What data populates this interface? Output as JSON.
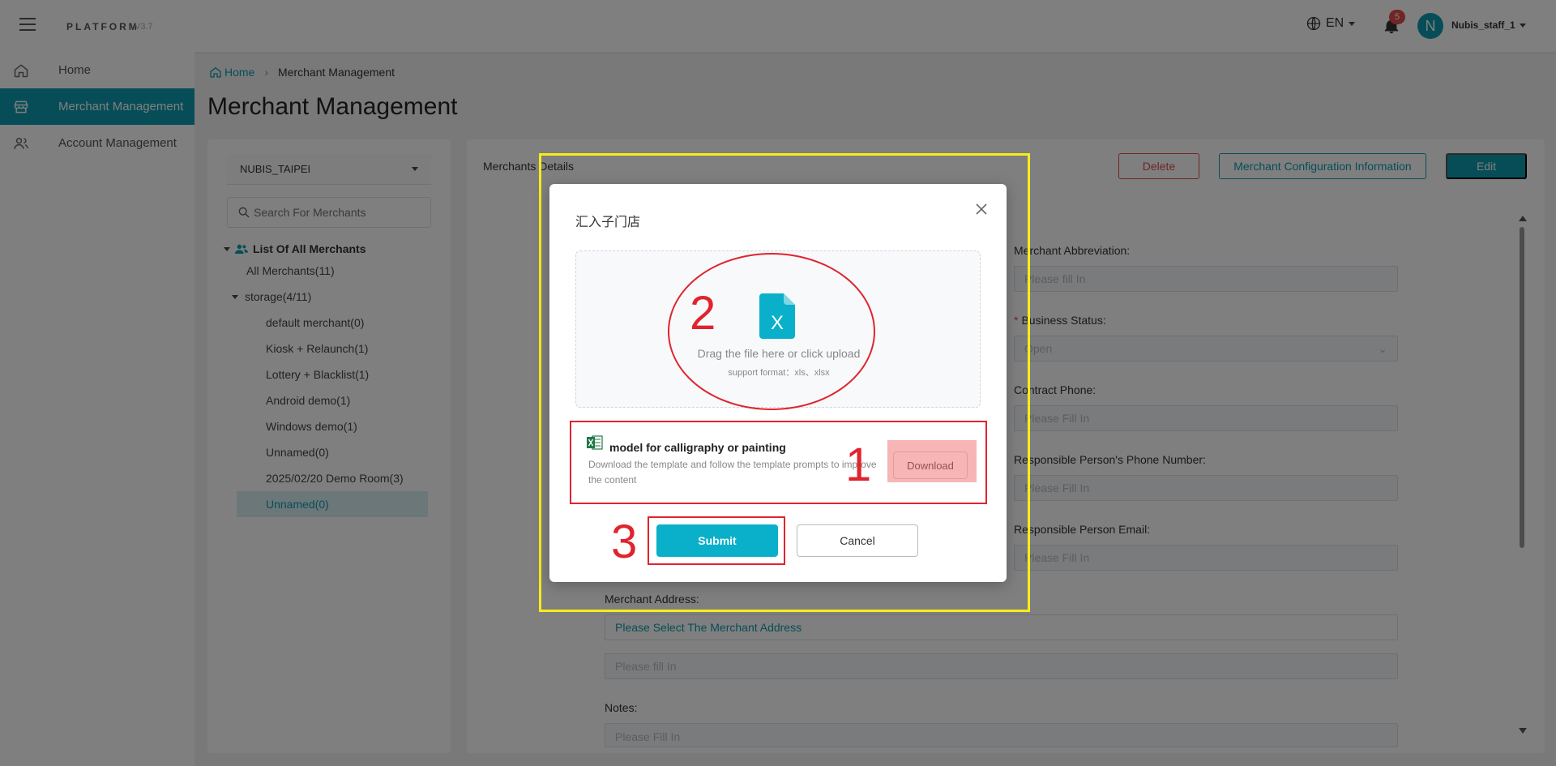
{
  "colors": {
    "brand": "#0e9bae",
    "danger": "#e24b4b",
    "annotation_red": "#e0242e",
    "annotation_yellow": "#f5ec1a"
  },
  "topbar": {
    "brand": "PLATFORM",
    "version": "V3.7",
    "language": "EN",
    "notification_count": "5",
    "avatar_letter": "N",
    "username": "Nubis_staff_1",
    "icons": [
      "menu-icon",
      "globe-icon",
      "bell-icon",
      "chevron-down-icon"
    ]
  },
  "sidebar": {
    "items": [
      {
        "label": "Home",
        "icon": "home-icon"
      },
      {
        "label": "Merchant Management",
        "icon": "store-icon"
      },
      {
        "label": "Account Management",
        "icon": "users-icon"
      }
    ]
  },
  "breadcrumb": {
    "home": "Home",
    "current": "Merchant Management"
  },
  "page_title": "Merchant Management",
  "left_panel": {
    "selected_org": "NUBIS_TAIPEI",
    "search_placeholder": "Search For Merchants",
    "tree_root": "List Of All Merchants",
    "all_merchants": "All Merchants(11)",
    "group": "storage(4/11)",
    "children": [
      "default merchant(0)",
      "Kiosk + Relaunch(1)",
      "Lottery + Blacklist(1)",
      "Android demo(1)",
      "Windows demo(1)",
      "Unnamed(0)",
      "2025/02/20 Demo Room(3)"
    ],
    "selected_child": "Unnamed(0)"
  },
  "right_panel": {
    "details_title": "Merchants Details",
    "delete_label": "Delete",
    "config_label": "Merchant Configuration Information",
    "edit_label": "Edit",
    "fields": {
      "abbreviation_label": "Merchant Abbreviation:",
      "abbreviation_placeholder": "Please fill In",
      "business_status_label": "Business Status:",
      "business_status_value": "Open",
      "contract_phone_label": "Contract Phone:",
      "contract_phone_placeholder": "Please Fill In",
      "resp_phone_label": "Responsible Person's Phone Number:",
      "resp_phone_placeholder": "Please Fill In",
      "resp_email_label": "Responsible Person Email:",
      "resp_email_placeholder": "Please Fill In",
      "address_label": "Merchant Address:",
      "address_select": "Please Select The Merchant Address",
      "address_detail_placeholder": "Please fill In",
      "notes_label": "Notes:",
      "notes_placeholder": "Please Fill In"
    }
  },
  "dialog": {
    "title": "汇入子门店",
    "upload_text": "Drag the file here or click upload",
    "upload_sub": "support format：xls、xlsx",
    "file_icon_letter": "X",
    "template_title": "model for calligraphy or painting",
    "template_desc": "Download the template and follow the template prompts to improve the content",
    "download_label": "Download",
    "submit_label": "Submit",
    "cancel_label": "Cancel"
  },
  "annotations": {
    "step1": "1",
    "step2": "2",
    "step3": "3"
  }
}
